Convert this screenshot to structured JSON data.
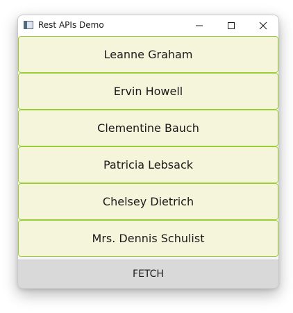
{
  "window": {
    "title": "Rest APIs Demo"
  },
  "titlebar": {
    "icons": [
      "app-icon",
      "minimize-icon",
      "maximize-icon",
      "close-icon"
    ]
  },
  "list": {
    "items": [
      {
        "label": "Leanne Graham"
      },
      {
        "label": "Ervin Howell"
      },
      {
        "label": "Clementine Bauch"
      },
      {
        "label": "Patricia Lebsack"
      },
      {
        "label": "Chelsey Dietrich"
      },
      {
        "label": "Mrs. Dennis Schulist"
      }
    ]
  },
  "actions": {
    "fetch_label": "FETCH"
  },
  "colors": {
    "item_background": "#f5f5dc",
    "item_border": "#9acd32",
    "button_background": "#d9d9d9"
  }
}
